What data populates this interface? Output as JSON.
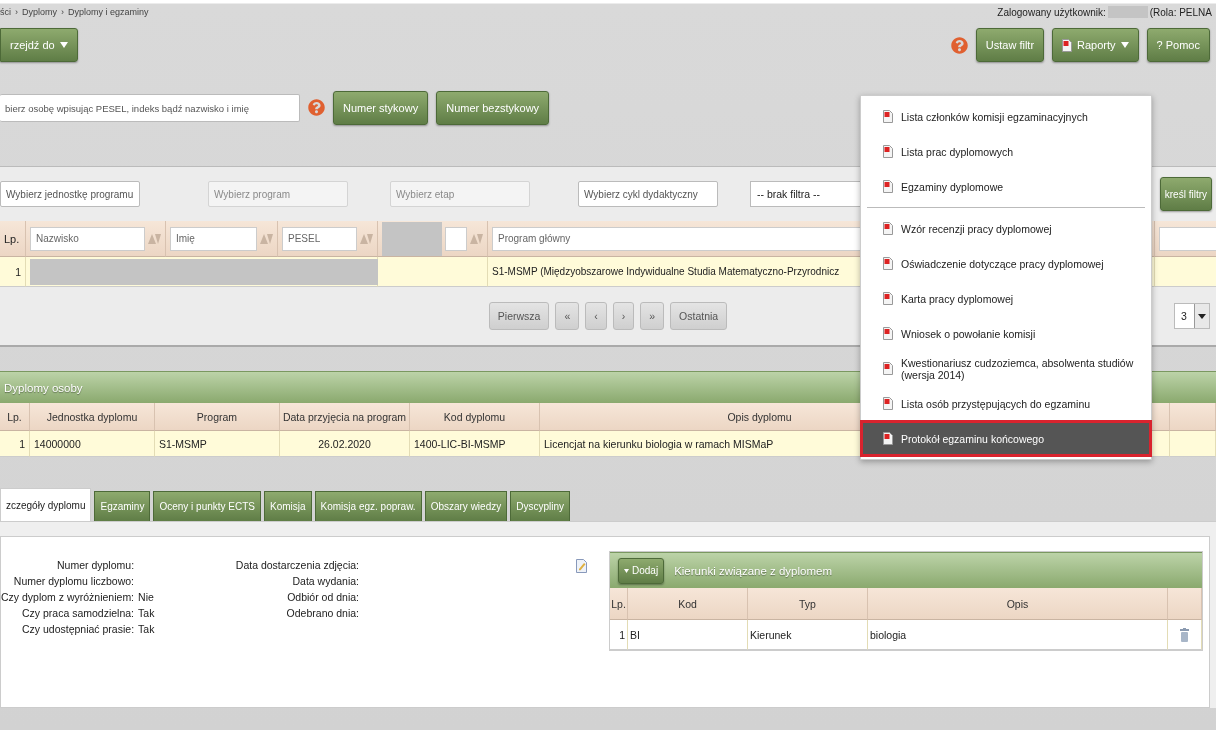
{
  "breadcrumb": {
    "items": [
      "ści",
      "Dyplomy",
      "Dyplomy i egzaminy"
    ],
    "separator": "›"
  },
  "user": {
    "label": "Zalogowany użytkownik:",
    "role": "(Rola: PELNA"
  },
  "goto_button": {
    "label": "rzejdź do"
  },
  "toolbar": [
    {
      "label": "Ustaw filtr",
      "kind": "plain"
    },
    {
      "label": "Raporty",
      "kind": "menu"
    },
    {
      "label": "? Pomoc",
      "kind": "plain"
    }
  ],
  "search": {
    "placeholder": "bierz osobę wpisując PESEL, indeks bądź nazwisko i imię",
    "buttons": [
      "Numer stykowy",
      "Numer bezstykowy"
    ]
  },
  "filters": [
    {
      "placeholder": "Wybierz jednostkę programu",
      "disabled": false
    },
    {
      "placeholder": "Wybierz program",
      "disabled": true
    },
    {
      "placeholder": "Wybierz etap",
      "disabled": true
    },
    {
      "placeholder": "Wybierz cykl dydaktyczny",
      "disabled": false
    }
  ],
  "filter_select": {
    "value": "-- brak filtra --"
  },
  "clear_button": {
    "label": "kreśl filtry"
  },
  "persons_table": {
    "columns": [
      {
        "label": "Lp.",
        "kind": "text"
      },
      {
        "placeholder": "Nazwisko",
        "kind": "filter"
      },
      {
        "placeholder": "Imię",
        "kind": "filter"
      },
      {
        "placeholder": "PESEL",
        "kind": "filter"
      },
      {
        "kind": "redacted"
      },
      {
        "placeholder": "Program główny",
        "kind": "filter"
      },
      {
        "kind": "filter"
      }
    ],
    "rows": [
      {
        "lp": "1",
        "program": "S1-MSMP (Międzyobszarowe Indywidualne Studia Matematyczno-Przyrodnicz"
      }
    ]
  },
  "pager": {
    "buttons": [
      "Pierwsza",
      "«",
      "‹",
      "›",
      "»",
      "Ostatnia"
    ],
    "page_size": "3"
  },
  "diplomas": {
    "title": "Dyplomy osoby",
    "columns": [
      "Lp.",
      "Jednostka dyplomu",
      "Program",
      "Data przyjęcia na program",
      "Kod dyplomu",
      "Opis dyplomu"
    ],
    "rows": [
      [
        "1",
        "14000000",
        "S1-MSMP",
        "26.02.2020",
        "1400-LIC-BI-MSMP",
        "Licencjat na kierunku biologia w ramach MISMaP"
      ]
    ]
  },
  "tabs": [
    {
      "label": "zczegóły dyplomu",
      "selected": true
    },
    {
      "label": "Egzaminy",
      "selected": false
    },
    {
      "label": "Oceny i punkty ECTS",
      "selected": false
    },
    {
      "label": "Komisja",
      "selected": false
    },
    {
      "label": "Komisja egz. popraw.",
      "selected": false
    },
    {
      "label": "Obszary wiedzy",
      "selected": false
    },
    {
      "label": "Dyscypliny",
      "selected": false
    }
  ],
  "details": {
    "left": [
      {
        "label": "Numer dyplomu:"
      },
      {
        "label": "Numer dyplomu liczbowo:"
      },
      {
        "label": "Czy dyplom z wyróżnieniem:",
        "value": "Nie"
      },
      {
        "label": "Czy praca samodzielna:",
        "value": "Tak"
      },
      {
        "label": "Czy udostępniać prasie:",
        "value": "Tak"
      }
    ],
    "right": [
      "Data dostarczenia zdjęcia:",
      "Data wydania:",
      "Odbiór od dnia:",
      "Odebrano dnia:"
    ]
  },
  "fields_panel": {
    "add_button": "Dodaj",
    "title": "Kierunki związane z dyplomem",
    "columns": [
      "Lp.",
      "Kod",
      "Typ",
      "Opis"
    ],
    "rows": [
      [
        "1",
        "BI",
        "Kierunek",
        "biologia"
      ]
    ]
  },
  "reports_menu": {
    "groups": [
      [
        {
          "label": "Lista członków komisji egzaminacyjnych",
          "selected": false
        },
        {
          "label": "Lista prac dyplomowych",
          "selected": false
        },
        {
          "label": "Egzaminy dyplomowe",
          "selected": false
        }
      ],
      [
        {
          "label": "Wzór recenzji pracy dyplomowej",
          "selected": false
        },
        {
          "label": "Oświadczenie dotyczące pracy dyplomowej",
          "selected": false
        },
        {
          "label": "Karta pracy dyplomowej",
          "selected": false
        },
        {
          "label": "Wniosek o powołanie komisji",
          "selected": false
        },
        {
          "label": "Kwestionariusz cudzoziemca, absolwenta studiów (wersja 2014)",
          "selected": false
        },
        {
          "label": "Lista osób przystępujących do egzaminu",
          "selected": false
        },
        {
          "label": "Protokół egzaminu końcowego",
          "selected": true
        }
      ]
    ]
  }
}
